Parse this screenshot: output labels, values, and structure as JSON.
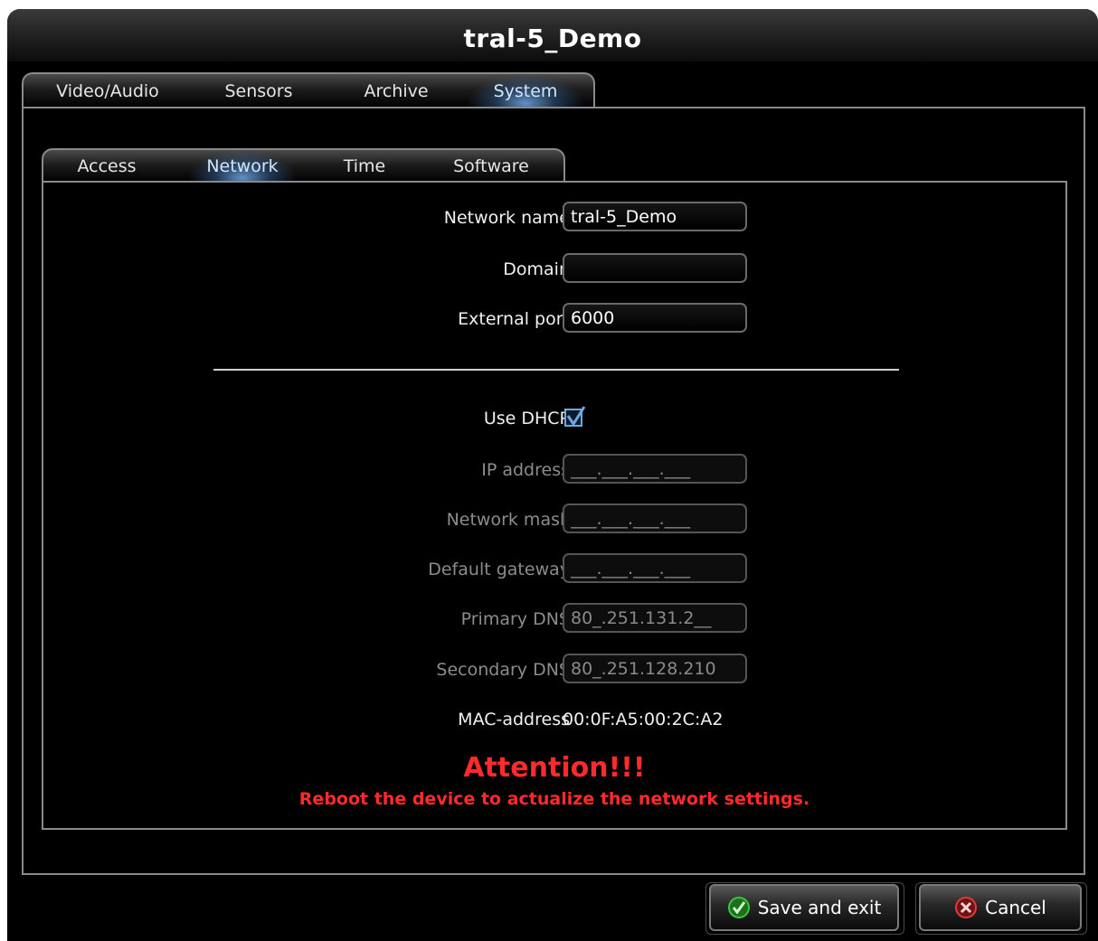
{
  "window": {
    "title": "tral-5_Demo"
  },
  "main_tabs": [
    {
      "label": "Video/Audio",
      "active": false
    },
    {
      "label": "Sensors",
      "active": false
    },
    {
      "label": "Archive",
      "active": false
    },
    {
      "label": "System",
      "active": true
    }
  ],
  "sub_tabs": [
    {
      "label": "Access",
      "active": false
    },
    {
      "label": "Network",
      "active": true
    },
    {
      "label": "Time",
      "active": false
    },
    {
      "label": "Software",
      "active": false
    }
  ],
  "form": {
    "network_name": {
      "label": "Network name",
      "value": "tral-5_Demo"
    },
    "domain": {
      "label": "Domain",
      "value": ""
    },
    "external_port": {
      "label": "External port",
      "value": "6000"
    },
    "use_dhcp": {
      "label": "Use DHCP",
      "checked": true
    },
    "ip_address": {
      "label": "IP address",
      "value": "___.___.___.___"
    },
    "network_mask": {
      "label": "Network mask",
      "value": "___.___.___.___"
    },
    "default_gateway": {
      "label": "Default gateway",
      "value": "___.___.___.___"
    },
    "primary_dns": {
      "label": "Primary DNS",
      "value": "80_.251.131.2__"
    },
    "secondary_dns": {
      "label": "Secondary DNS",
      "value": "80_.251.128.210"
    },
    "mac_address": {
      "label": "MAC-address",
      "value": "00:0F:A5:00:2C:A2"
    }
  },
  "attention": {
    "title": "Attention!!!",
    "message": "Reboot the device to actualize the network settings."
  },
  "buttons": {
    "save_label": "Save and exit",
    "cancel_label": "Cancel"
  },
  "colors": {
    "accent_red": "#ff2a2a",
    "checkbox_blue": "#6fa8e0",
    "save_icon_green": "#3cc63c",
    "cancel_icon_red": "#e03a3a"
  }
}
